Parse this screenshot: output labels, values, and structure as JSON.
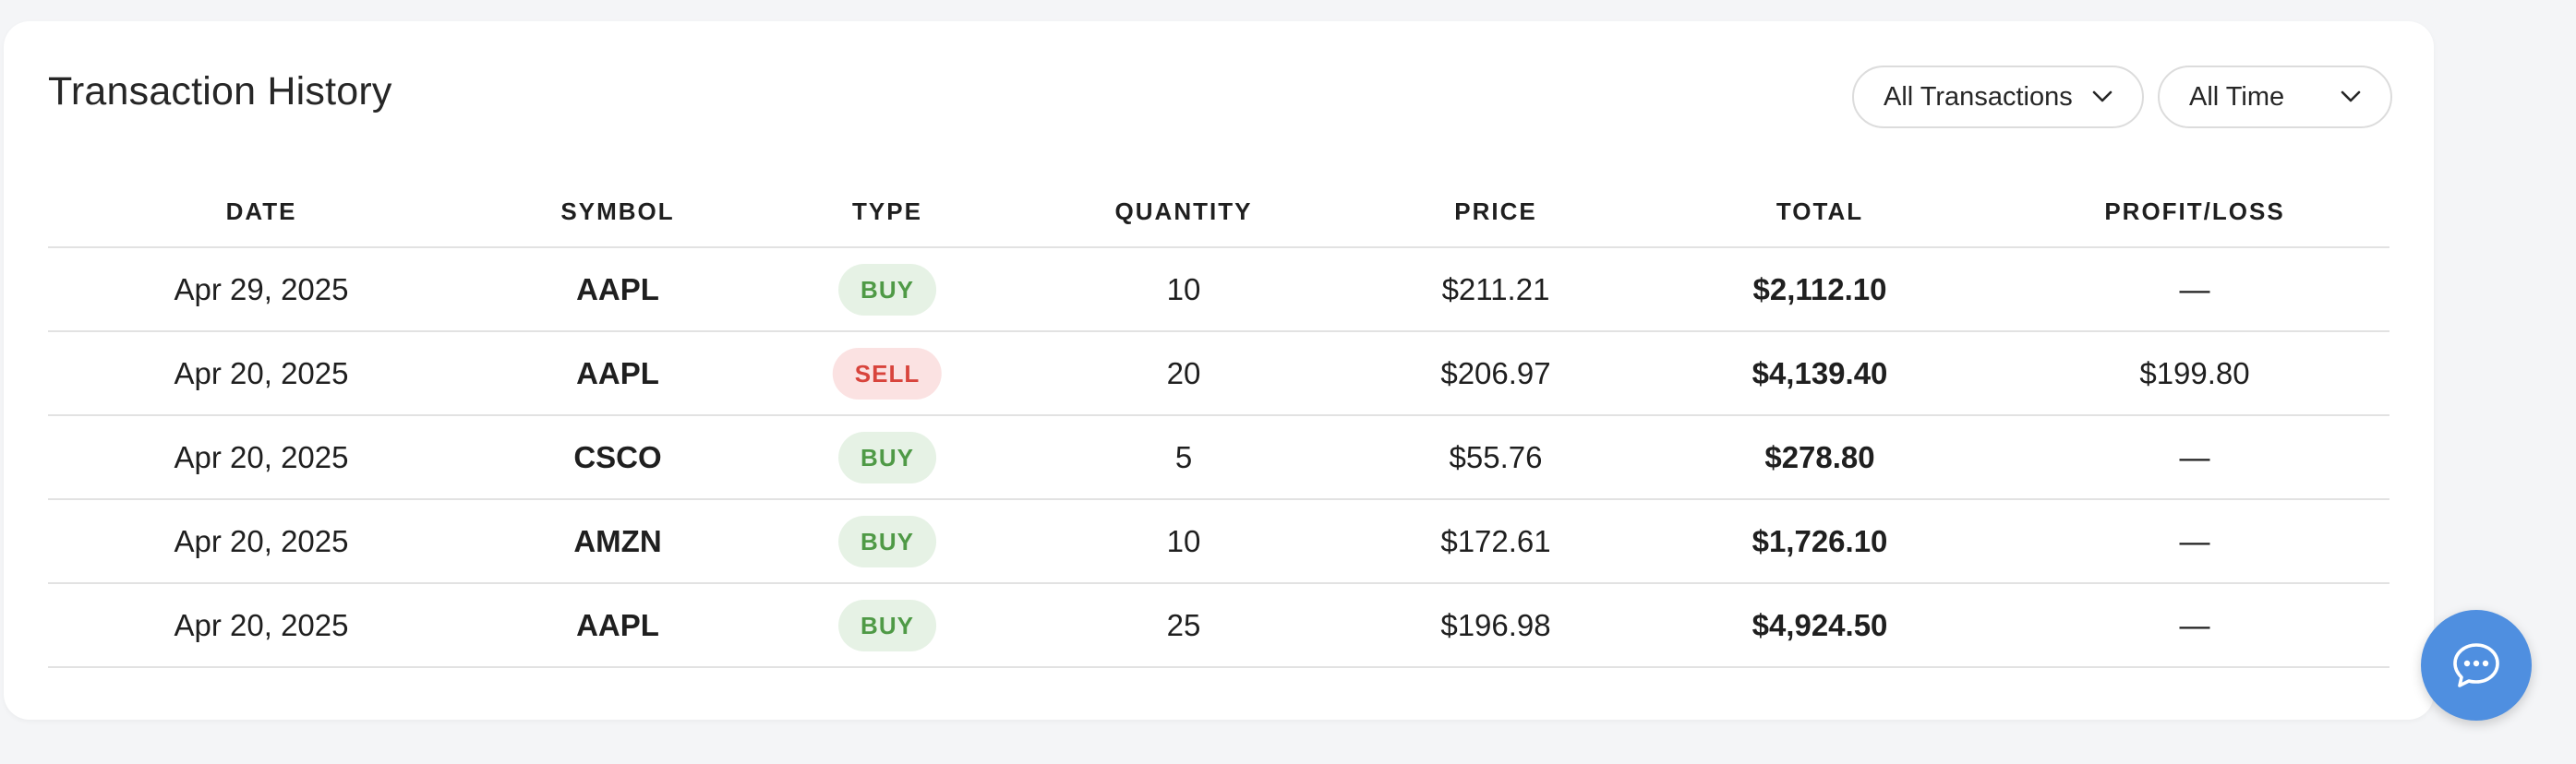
{
  "header": {
    "title": "Transaction History"
  },
  "filters": {
    "type_filter": "All Transactions",
    "time_filter": "All Time"
  },
  "table": {
    "columns": [
      "DATE",
      "SYMBOL",
      "TYPE",
      "QUANTITY",
      "PRICE",
      "TOTAL",
      "PROFIT/LOSS"
    ],
    "rows": [
      {
        "date": "Apr 29, 2025",
        "symbol": "AAPL",
        "type": "BUY",
        "quantity": "10",
        "price": "$211.21",
        "total": "$2,112.10",
        "profit_loss": "—"
      },
      {
        "date": "Apr 20, 2025",
        "symbol": "AAPL",
        "type": "SELL",
        "quantity": "20",
        "price": "$206.97",
        "total": "$4,139.40",
        "profit_loss": "$199.80"
      },
      {
        "date": "Apr 20, 2025",
        "symbol": "CSCO",
        "type": "BUY",
        "quantity": "5",
        "price": "$55.76",
        "total": "$278.80",
        "profit_loss": "—"
      },
      {
        "date": "Apr 20, 2025",
        "symbol": "AMZN",
        "type": "BUY",
        "quantity": "10",
        "price": "$172.61",
        "total": "$1,726.10",
        "profit_loss": "—"
      },
      {
        "date": "Apr 20, 2025",
        "symbol": "AAPL",
        "type": "BUY",
        "quantity": "25",
        "price": "$196.98",
        "total": "$4,924.50",
        "profit_loss": "—"
      }
    ]
  },
  "colors": {
    "buy_bg": "#e6f2e5",
    "buy_text": "#4f9a46",
    "sell_bg": "#fbe2e2",
    "sell_text": "#d8443c",
    "chat_button": "#4f8fe0"
  },
  "icons": {
    "dropdown": "chevron-down-icon",
    "chat": "chat-bubble-icon"
  }
}
